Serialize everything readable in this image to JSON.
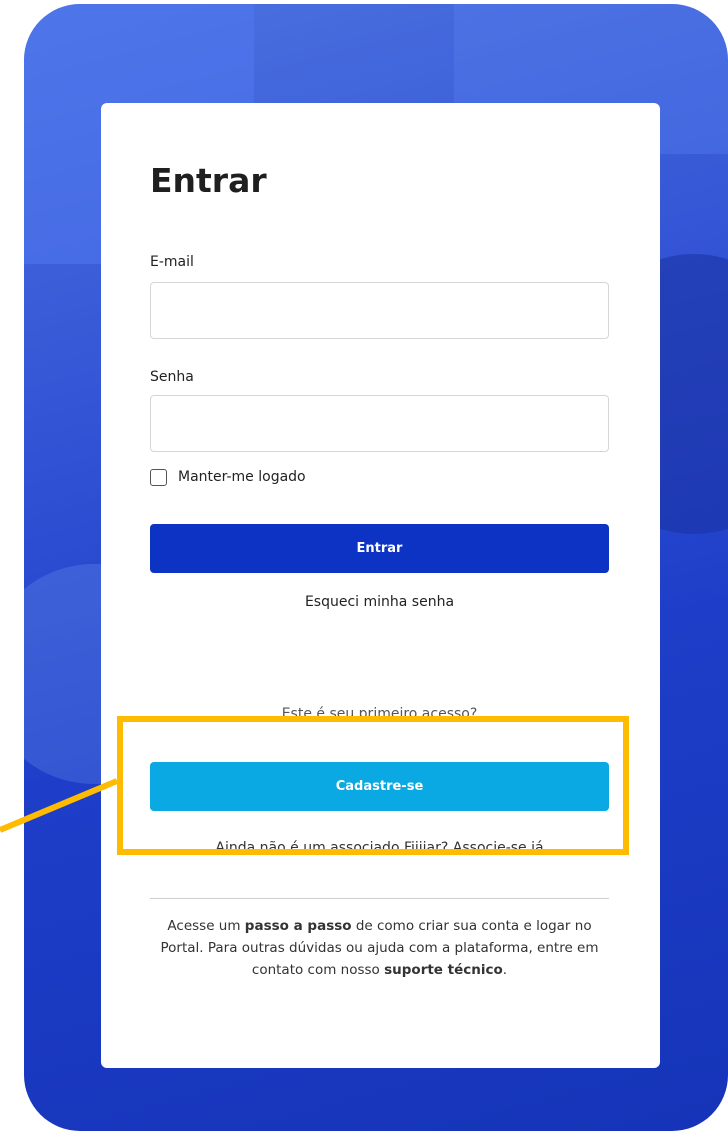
{
  "login": {
    "title": "Entrar",
    "email_label": "E-mail",
    "email_value": "",
    "password_label": "Senha",
    "password_value": "",
    "remember_label": "Manter-me logado",
    "remember_checked": false,
    "submit_label": "Entrar",
    "forgot_label": "Esqueci minha senha"
  },
  "signup": {
    "first_access_text": "Este é seu primeiro acesso?",
    "register_label": "Cadastre-se",
    "not_member_text": "Ainda não é um associado Fiiijar?",
    "join_label": "Associe-se já"
  },
  "help": {
    "part1": "Acesse um ",
    "link1": "passo a passo",
    "part2": " de como criar sua conta e logar no Portal. Para outras dúvidas ou ajuda com a plataforma, entre em contato com nosso ",
    "link2": "suporte técnico",
    "part3": "."
  },
  "colors": {
    "background": "#2a4bd0",
    "primary_button": "#0c33c4",
    "secondary_button": "#0aa9e3",
    "highlight": "#ffbb00"
  }
}
